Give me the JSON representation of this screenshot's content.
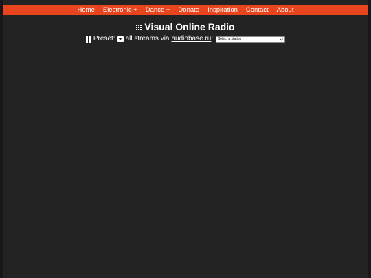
{
  "nav": {
    "items": [
      {
        "label": "Home"
      },
      {
        "label": "Electronic +"
      },
      {
        "label": "Dance +"
      },
      {
        "label": "Donate"
      },
      {
        "label": "Inspiration"
      },
      {
        "label": "Contact"
      },
      {
        "label": "About"
      }
    ]
  },
  "header": {
    "title": "Visual Online Radio",
    "title_icon": "grid-icon"
  },
  "controls": {
    "pause_icon": "pause-icon",
    "preset_label": "Preset:",
    "preset_icon": "chevron-down-icon",
    "streams_text": "all streams via",
    "source_link": "audiobase.ru",
    "colon": ":",
    "station_select": {
      "selected": "Select a station"
    }
  },
  "colors": {
    "accent": "#e8451f",
    "background": "#232323",
    "text": "#ffffff"
  }
}
